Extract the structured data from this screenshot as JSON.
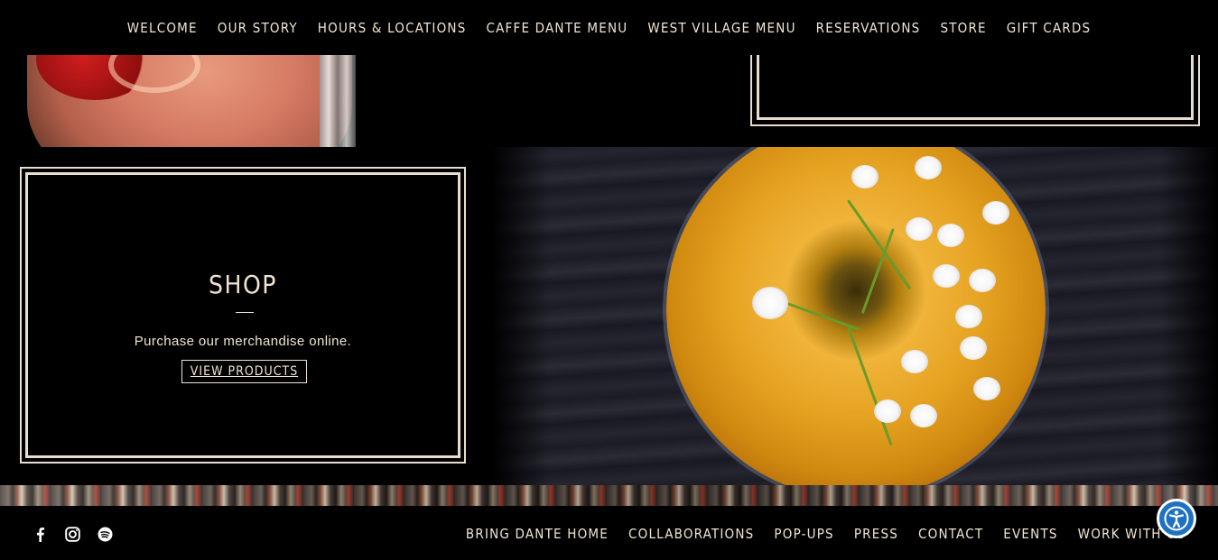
{
  "top_nav": {
    "items": [
      {
        "label": "WELCOME"
      },
      {
        "label": "OUR STORY"
      },
      {
        "label": "HOURS & LOCATIONS"
      },
      {
        "label": "CAFFE DANTE MENU"
      },
      {
        "label": "WEST VILLAGE MENU"
      },
      {
        "label": "RESERVATIONS"
      },
      {
        "label": "STORE"
      },
      {
        "label": "GIFT CARDS"
      }
    ]
  },
  "shop": {
    "title": "SHOP",
    "description": "Purchase our merchandise online.",
    "button_label": "VIEW PRODUCTS"
  },
  "footer": {
    "social_icons": [
      "facebook-icon",
      "instagram-icon",
      "spotify-icon"
    ],
    "nav": [
      {
        "label": "BRING DANTE HOME"
      },
      {
        "label": "COLLABORATIONS"
      },
      {
        "label": "POP-UPS"
      },
      {
        "label": "PRESS"
      },
      {
        "label": "CONTACT"
      },
      {
        "label": "EVENTS"
      },
      {
        "label": "WORK WITH US"
      }
    ]
  },
  "colors": {
    "text": "#f1e4d3",
    "background": "#000000",
    "accessibility": "#1f71c1"
  }
}
